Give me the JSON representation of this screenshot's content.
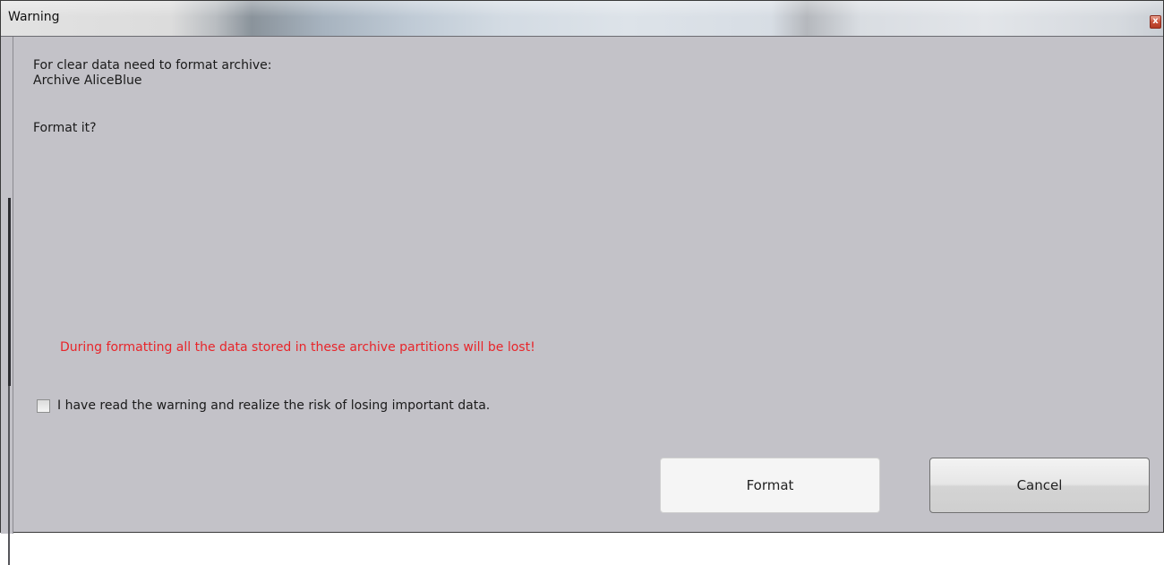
{
  "window": {
    "title": "Warning",
    "close_glyph": "x"
  },
  "message": {
    "line1": "For clear data need to format archive:",
    "line2": "Archive AliceBlue",
    "line3": "Format it?"
  },
  "warning": {
    "text": "During formatting all the data stored in these archive partitions will be lost!",
    "color": "#e8252a"
  },
  "acknowledge": {
    "label": "I have read the warning and realize the risk of losing important data.",
    "checked": false
  },
  "buttons": {
    "format_label": "Format",
    "cancel_label": "Cancel"
  }
}
